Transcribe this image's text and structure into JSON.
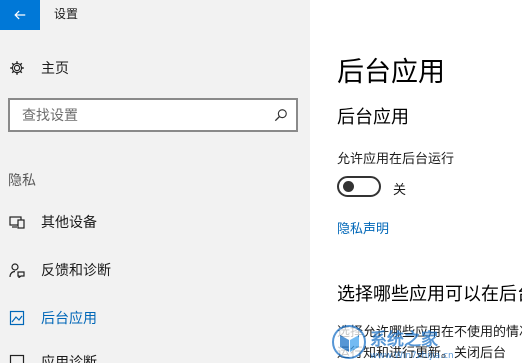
{
  "window": {
    "title": "设置"
  },
  "sidebar": {
    "home_label": "主页",
    "search_placeholder": "查找设置",
    "section_label": "隐私",
    "items": [
      {
        "label": "其他设备",
        "icon": "devices-icon"
      },
      {
        "label": "反馈和诊断",
        "icon": "feedback-icon"
      },
      {
        "label": "后台应用",
        "icon": "background-apps-icon",
        "active": true
      },
      {
        "label": "应用诊断",
        "icon": "app-diagnostics-icon"
      }
    ]
  },
  "main": {
    "page_title": "后台应用",
    "subtitle": "后台应用",
    "toggle_description": "允许应用在后台运行",
    "toggle_state": "关",
    "privacy_link": "隐私声明",
    "section_title": "选择哪些应用可以在后台运行",
    "section_desc_line1": "选择允许哪些应用在不使用的情况下在后台",
    "section_desc_line2": "运行知和进行更新。关闭后台"
  },
  "watermark": {
    "text": "系统之家",
    "url_text": "www.Win7zhijia.cn"
  },
  "colors": {
    "accent": "#0078d7",
    "link": "#0067b8",
    "sidebar_bg": "#f2f2f2"
  }
}
